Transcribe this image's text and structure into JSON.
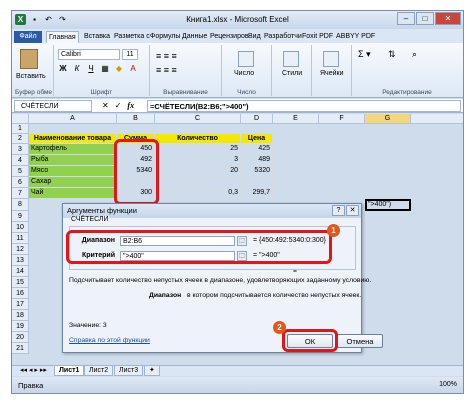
{
  "window": {
    "title": "Книга1.xlsx - Microsoft Excel"
  },
  "ribbon_tabs": [
    "Файл",
    "Главная",
    "Вставка",
    "Разметка с",
    "Формулы",
    "Данные",
    "Рецензиров",
    "Вид",
    "Разработчи",
    "Foxit PDF",
    "ABBYY PDF"
  ],
  "ribbon": {
    "paste_label": "Вставить",
    "clipboard_label": "Буфер обме",
    "font_name": "Calibri",
    "font_size": "11",
    "font_label": "Шрифт",
    "align_label": "Выравнивание",
    "number_label": "Число",
    "number_btn": "Число",
    "styles_btn": "Стили",
    "cells_btn": "Ячейки",
    "editing_label": "Редактирование"
  },
  "formula_bar": {
    "name_box": "СЧЁТЕСЛИ",
    "formula": "=СЧЁТЕСЛИ(B2:B6;\">400\")"
  },
  "columns": [
    "A",
    "B",
    "C",
    "D",
    "E",
    "F",
    "G"
  ],
  "rows": [
    "1",
    "2",
    "3",
    "4",
    "5",
    "6",
    "7",
    "8",
    "9",
    "10",
    "11",
    "12",
    "13",
    "14",
    "15",
    "16",
    "17",
    "18",
    "19",
    "20",
    "21"
  ],
  "table": {
    "headers": [
      "Наименование товара",
      "Сумма",
      "Количество",
      "Цена"
    ],
    "rows": [
      [
        "Картофель",
        "450",
        "25",
        "425"
      ],
      [
        "Рыба",
        "492",
        "3",
        "489"
      ],
      [
        "Мясо",
        "5340",
        "20",
        "5320"
      ],
      [
        "Сахар",
        "",
        "",
        ""
      ],
      [
        "Чай",
        "300",
        "0,3",
        "299,7"
      ]
    ],
    "g6": "\">400\")"
  },
  "sheets": [
    "Лист1",
    "Лист2",
    "Лист3"
  ],
  "status": {
    "mode": "Правка",
    "zoom": "100%"
  },
  "dialog": {
    "title": "Аргументы функции",
    "func": "СЧЁТЕСЛИ",
    "arg1_label": "Диапазон",
    "arg1_value": "B2:B6",
    "arg1_result": "= {450:492:5340:0:300}",
    "arg2_label": "Критерий",
    "arg2_value": "\">400\"",
    "arg2_result": "= \">400\"",
    "result_eq": "=",
    "description": "Подсчитывает количество непустых ячеек в диапазоне, удовлетворяющих заданному условию.",
    "arg_help_label": "Диапазон",
    "arg_help": "в котором подсчитывается количество непустых ячеек.",
    "value_text": "Значение: 3",
    "help_link": "Справка по этой функции",
    "ok": "ОК",
    "cancel": "Отмена"
  },
  "badges": [
    "1",
    "2"
  ],
  "colors": {
    "header_yellow": "#f2e800",
    "green": "#92d050",
    "highlight_red": "#e0161a",
    "badge_orange": "#e5561d"
  }
}
